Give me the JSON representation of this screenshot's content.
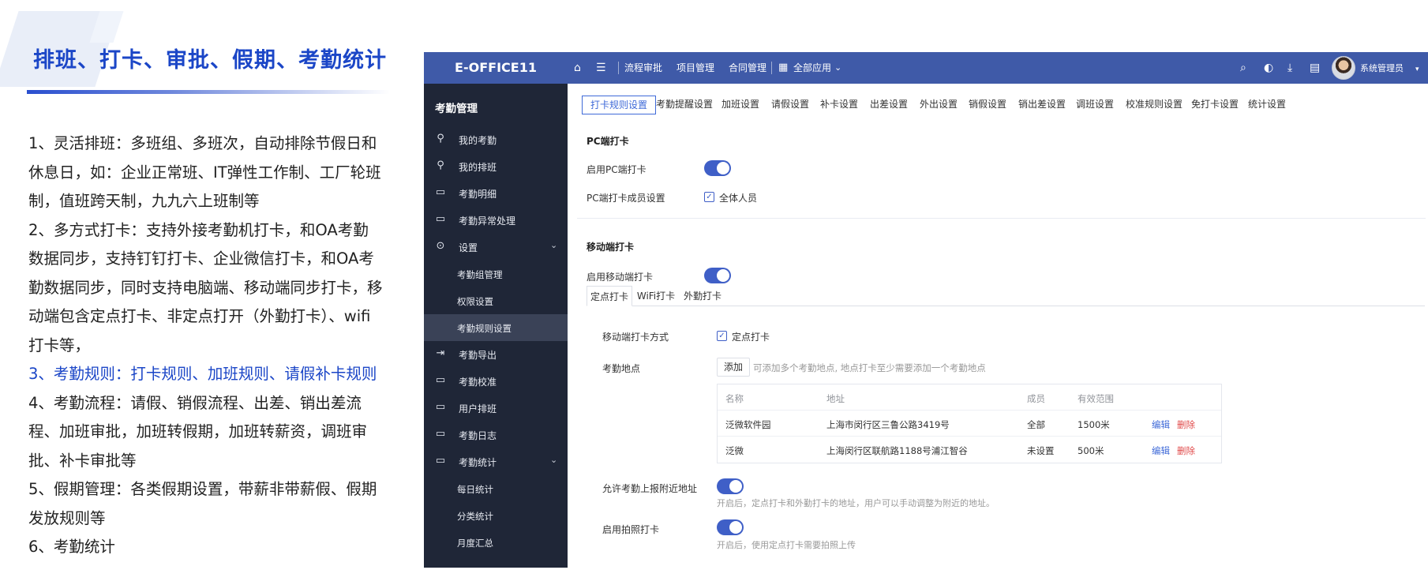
{
  "page": {
    "title": "排班、打卡、审批、假期、考勤统计",
    "features": [
      {
        "text": "1、灵活排班：多班组、多班次，自动排除节假日和休息日，如：企业正常班、IT弹性工作制、工厂轮班制，值班跨天制，九九六上班制等",
        "highlight": false
      },
      {
        "text": "2、多方式打卡：支持外接考勤机打卡，和OA考勤数据同步，支持钉钉打卡、企业微信打卡，和OA考勤数据同步，同时支持电脑端、移动端同步打卡，移动端包含定点打卡、非定点打开（外勤打卡）、wifi打卡等，",
        "highlight": false
      },
      {
        "text": "3、考勤规则：打卡规则、加班规则、请假补卡规则",
        "highlight": true
      },
      {
        "text": "4、考勤流程：请假、销假流程、出差、销出差流程、加班审批，加班转假期，加班转薪资，调班审批、补卡审批等",
        "highlight": false
      },
      {
        "text": "5、假期管理：各类假期设置，带薪非带薪假、假期发放规则等",
        "highlight": false
      },
      {
        "text": "6、考勤统计",
        "highlight": false
      }
    ]
  },
  "app": {
    "brand": "E-OFFICE11",
    "nav": [
      "流程审批",
      "项目管理",
      "合同管理"
    ],
    "all_apps": "全部应用",
    "user": "系统管理员",
    "icons": [
      "home-icon",
      "menu-icon",
      "grid-icon",
      "search-icon",
      "contrast-icon",
      "download-icon",
      "list-icon"
    ]
  },
  "sidebar": {
    "title": "考勤管理",
    "items": [
      {
        "label": "我的考勤",
        "icon": "person-icon"
      },
      {
        "label": "我的排班",
        "icon": "person-shift-icon"
      },
      {
        "label": "考勤明细",
        "icon": "calendar-detail-icon"
      },
      {
        "label": "考勤异常处理",
        "icon": "calendar-alert-icon"
      },
      {
        "label": "设置",
        "icon": "settings-icon"
      },
      {
        "label": "考勤组管理"
      },
      {
        "label": "权限设置"
      },
      {
        "label": "考勤规则设置"
      },
      {
        "label": "考勤导出",
        "icon": "export-icon"
      },
      {
        "label": "考勤校准",
        "icon": "calibrate-icon"
      },
      {
        "label": "用户排班",
        "icon": "user-schedule-icon"
      },
      {
        "label": "考勤日志",
        "icon": "log-icon"
      },
      {
        "label": "考勤统计",
        "icon": "stats-icon"
      },
      {
        "label": "每日统计"
      },
      {
        "label": "分类统计"
      },
      {
        "label": "月度汇总"
      }
    ]
  },
  "tabs": [
    "打卡规则设置",
    "考勤提醒设置",
    "加班设置",
    "请假设置",
    "补卡设置",
    "出差设置",
    "外出设置",
    "销假设置",
    "销出差设置",
    "调班设置",
    "校准规则设置",
    "免打卡设置",
    "统计设置"
  ],
  "pc": {
    "section": "PC端打卡",
    "enable_label": "启用PC端打卡",
    "members_label": "PC端打卡成员设置",
    "members_value": "全体人员"
  },
  "mobile": {
    "section": "移动端打卡",
    "enable_label": "启用移动端打卡",
    "subtabs": [
      "定点打卡",
      "WiFi打卡",
      "外勤打卡"
    ],
    "method_label": "移动端打卡方式",
    "method_value": "定点打卡",
    "location_label": "考勤地点",
    "add_button": "添加",
    "add_hint": "可添加多个考勤地点, 地点打卡至少需要添加一个考勤地点",
    "table": {
      "headers": [
        "名称",
        "地址",
        "成员",
        "有效范围"
      ],
      "rows": [
        {
          "name": "泛微软件园",
          "address": "上海市闵行区三鲁公路3419号",
          "members": "全部",
          "range": "1500米",
          "edit": "编辑",
          "delete": "删除"
        },
        {
          "name": "泛微",
          "address": "上海闵行区联航路1188号浦江智谷",
          "members": "未设置",
          "range": "500米",
          "edit": "编辑",
          "delete": "删除"
        }
      ]
    },
    "nearby_label": "允许考勤上报附近地址",
    "nearby_note": "开启后，定点打卡和外勤打卡的地址，用户可以手动调整为附近的地址。",
    "photo_label": "启用拍照打卡",
    "photo_note": "开启后，使用定点打卡需要拍照上传"
  }
}
